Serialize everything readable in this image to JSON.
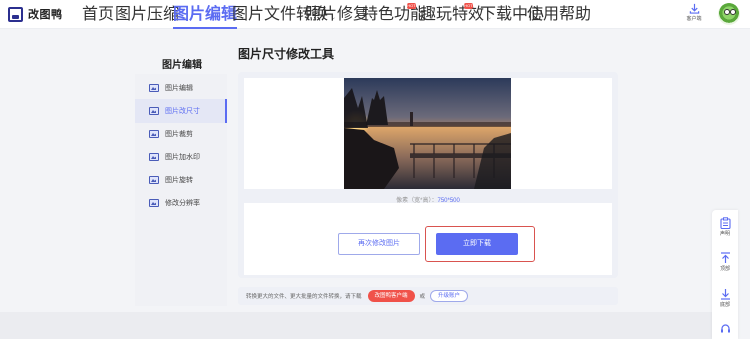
{
  "logo": {
    "text": "改图鸭"
  },
  "nav": [
    {
      "label": "首页",
      "has_chevron": false,
      "active": false
    },
    {
      "label": "图片压缩",
      "has_chevron": true,
      "active": false
    },
    {
      "label": "图片编辑",
      "has_chevron": true,
      "active": true
    },
    {
      "label": "图片文件转换",
      "has_chevron": true,
      "active": false
    },
    {
      "label": "照片修复",
      "has_chevron": true,
      "active": false
    },
    {
      "label": "特色功能",
      "has_chevron": true,
      "active": false,
      "badge": "HOT"
    },
    {
      "label": "趣玩特效",
      "has_chevron": true,
      "active": false,
      "badge": "HOT"
    },
    {
      "label": "下载中心",
      "has_chevron": false,
      "active": false
    },
    {
      "label": "使用帮助",
      "has_chevron": false,
      "active": false
    }
  ],
  "header_right": {
    "client_label": "客户端"
  },
  "sidebar": {
    "title": "图片编辑",
    "items": [
      {
        "label": "图片编辑",
        "active": false
      },
      {
        "label": "图片改尺寸",
        "active": true
      },
      {
        "label": "图片裁剪",
        "active": false
      },
      {
        "label": "图片加水印",
        "active": false
      },
      {
        "label": "图片旋转",
        "active": false
      },
      {
        "label": "修改分辨率",
        "active": false
      }
    ]
  },
  "main": {
    "title": "图片尺寸修改工具",
    "size_label": "像素（宽*高）：",
    "size_value": "750*500",
    "again_button": "再次修改图片",
    "download_button": "立即下载"
  },
  "tip": {
    "text": "转换更大的文件、更大批量的文件转换，请下载",
    "client_button": "改图鸭客户端",
    "or": "或",
    "upgrade_button": "升级账户"
  },
  "right_float": {
    "items": [
      {
        "label": "声明",
        "icon": "clipboard-icon"
      },
      {
        "label": "顶部",
        "icon": "back-to-top-icon"
      },
      {
        "label": "底部",
        "icon": "scroll-bottom-icon"
      },
      {
        "label": "",
        "icon": "headset-icon"
      }
    ]
  },
  "colors": {
    "accent": "#5b6cf2",
    "hot": "#f0524a",
    "highlight_frame": "#d9534f"
  }
}
